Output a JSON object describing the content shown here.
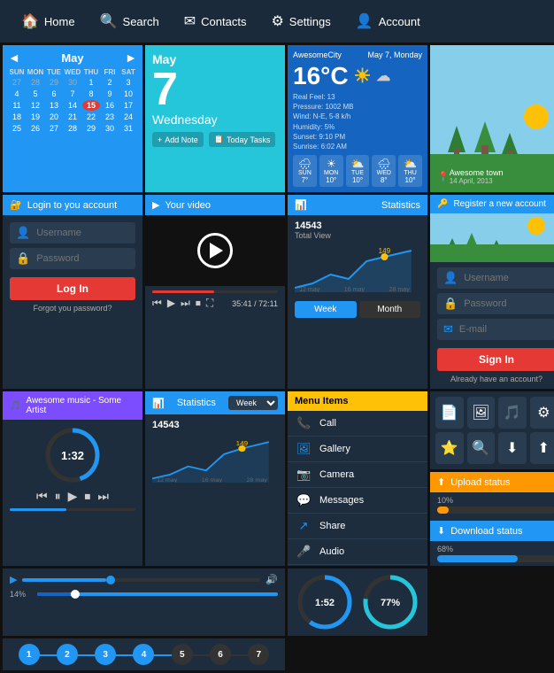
{
  "navbar": {
    "items": [
      {
        "id": "home",
        "label": "Home",
        "icon": "🏠"
      },
      {
        "id": "search",
        "label": "Search",
        "icon": "🔍"
      },
      {
        "id": "contacts",
        "label": "Contacts",
        "icon": "✉"
      },
      {
        "id": "settings",
        "label": "Settings",
        "icon": "⚙"
      },
      {
        "id": "account",
        "label": "Account",
        "icon": "👤"
      }
    ]
  },
  "calendar": {
    "title": "May",
    "days_header": [
      "SUN",
      "MON",
      "TUE",
      "WED",
      "THU",
      "FRI",
      "SAT"
    ],
    "weeks": [
      [
        "27",
        "28",
        "29",
        "30",
        "1",
        "2",
        "3"
      ],
      [
        "4",
        "5",
        "6",
        "7",
        "8",
        "9",
        "10"
      ],
      [
        "11",
        "12",
        "13",
        "14",
        "15",
        "16",
        "17"
      ],
      [
        "18",
        "19",
        "20",
        "21",
        "22",
        "23",
        "24"
      ],
      [
        "25",
        "26",
        "27",
        "28",
        "29",
        "30",
        "31"
      ]
    ],
    "today": "15"
  },
  "date_widget": {
    "month": "May",
    "day_number": "7",
    "day_name": "Wednesday",
    "add_note": "+ Add Note",
    "today_tasks": "Today Tasks"
  },
  "weather": {
    "city": "AwesomeCity",
    "date": "May 7, Monday",
    "temp": "16°C",
    "real_feel": "Real Feel: 13",
    "pressure": "Pressure: 1002 MB",
    "wind": "Wind: N-E, 5-8 k/h",
    "humidity": "Humidity: 5%",
    "sunset": "Sunset: 9:10 PM",
    "sunrise": "Sunrise: 6:02 AM",
    "forecast": [
      {
        "day": "SUN",
        "icon": "🌧",
        "temp": "7°"
      },
      {
        "day": "MON",
        "icon": "☀",
        "temp": "10°"
      },
      {
        "day": "TUE",
        "icon": "⛅",
        "temp": "10°"
      },
      {
        "day": "WED",
        "icon": "🌧",
        "temp": "8°"
      },
      {
        "day": "THU",
        "icon": "⛅",
        "temp": "10°"
      }
    ]
  },
  "landscape": {
    "location": "Awesome town",
    "date": "14 April, 2013"
  },
  "login": {
    "header": "Login to you account",
    "username_placeholder": "Username",
    "password_placeholder": "Password",
    "login_btn": "Log In",
    "forgot": "Forgot you password?"
  },
  "video": {
    "header": "Your video",
    "time_current": "35:41",
    "time_total": "72:11"
  },
  "statistics": {
    "header": "Statistics",
    "total_label": "14543",
    "total_sub": "Total View",
    "peak": "149",
    "tab_week": "Week",
    "tab_month": "Month",
    "x_labels": [
      "12 may",
      "16 may",
      "28 may"
    ]
  },
  "statistics2": {
    "header": "Statistics",
    "dropdown": "Week",
    "total_label": "14543",
    "peak": "149",
    "x_labels": [
      "12 may",
      "16 may",
      "28 may"
    ]
  },
  "music": {
    "header": "Awesome music - Some Artist",
    "time": "1:32",
    "progress_pct": 45
  },
  "menu": {
    "header": "Menu Items",
    "items": [
      {
        "icon": "📞",
        "label": "Call"
      },
      {
        "icon": "🖼",
        "label": "Gallery"
      },
      {
        "icon": "📷",
        "label": "Camera"
      },
      {
        "icon": "💬",
        "label": "Messages"
      },
      {
        "icon": "↗",
        "label": "Share"
      },
      {
        "icon": "🎤",
        "label": "Audio"
      }
    ]
  },
  "register": {
    "header": "Register a new account",
    "username_placeholder": "Username",
    "password_placeholder": "Password",
    "email_placeholder": "E-mail",
    "sign_btn": "Sign In",
    "already": "Already have an account?"
  },
  "icon_grid": {
    "icons": [
      "📄",
      "🖼",
      "🎵",
      "⚙",
      "⭐",
      "🔍",
      "⬇",
      "⬆"
    ]
  },
  "upload_status": {
    "header": "Upload status",
    "pct": 10,
    "color": "#ff9800"
  },
  "download_status": {
    "header": "Download status",
    "pct": 68,
    "color": "#2196f3"
  },
  "sliders": {
    "slider1": {
      "label": "14%",
      "pct": 14
    },
    "steps": [
      "1",
      "2",
      "3",
      "4",
      "5",
      "6",
      "7"
    ]
  },
  "circular": {
    "time_label": "1:52",
    "percent_label": "77%",
    "time_pct": 60,
    "percent_pct": 77
  }
}
